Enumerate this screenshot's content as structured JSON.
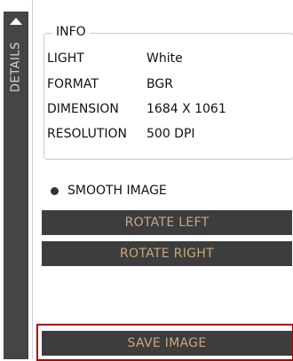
{
  "side_tab": {
    "label": "DETAILS",
    "icon": "triangle-up-icon"
  },
  "info": {
    "title": "INFO",
    "rows": [
      {
        "key": "LIGHT",
        "value": "White"
      },
      {
        "key": "FORMAT",
        "value": "BGR"
      },
      {
        "key": "DIMENSION",
        "value": "1684 X 1061"
      },
      {
        "key": "RESOLUTION",
        "value": "500 DPI"
      }
    ]
  },
  "options": {
    "smooth_image_label": "SMOOTH IMAGE"
  },
  "buttons": {
    "rotate_left": "ROTATE LEFT",
    "rotate_right": "ROTATE RIGHT",
    "save_image": "SAVE IMAGE"
  },
  "colors": {
    "button_bg": "#3d3d3d",
    "button_text": "#c8a77e",
    "side_strip": "#454545",
    "highlight": "#b00000"
  }
}
